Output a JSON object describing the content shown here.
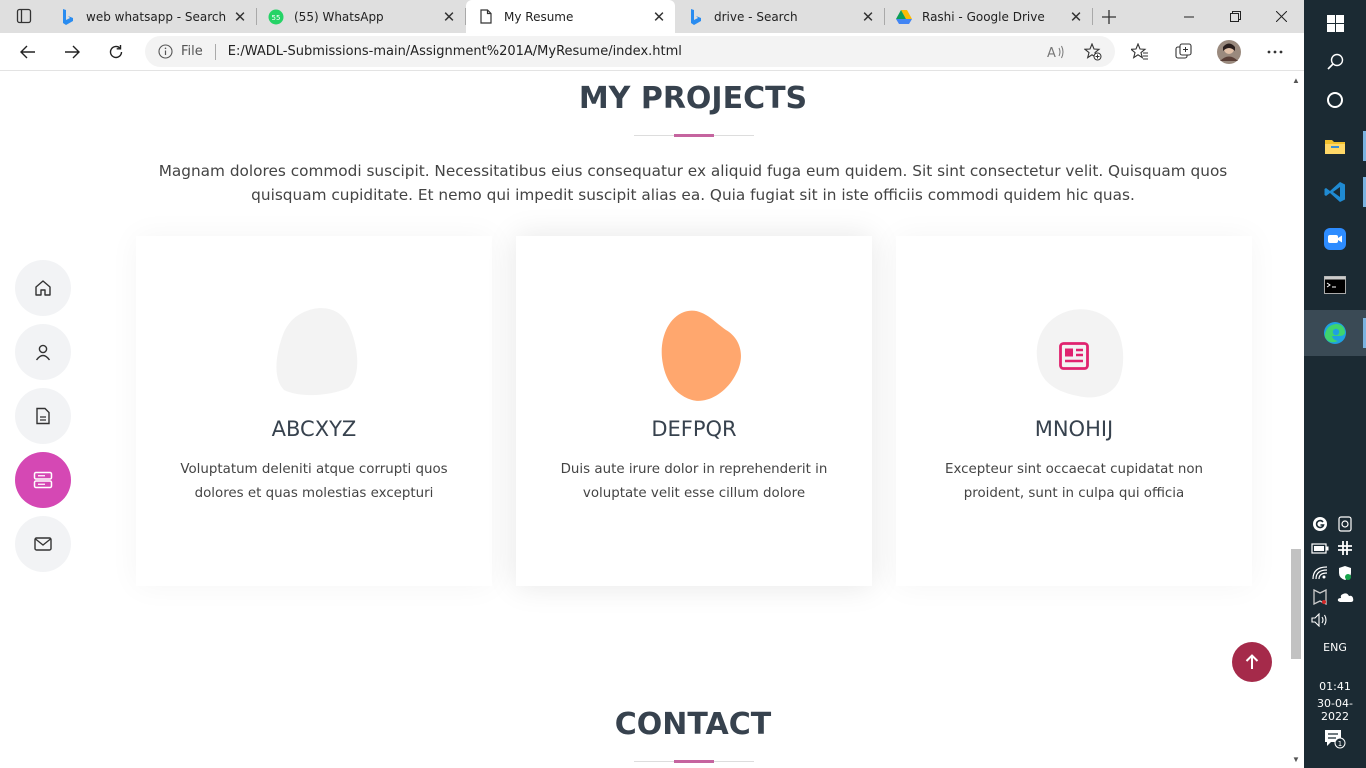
{
  "browser": {
    "tabs": [
      {
        "title": "web whatsapp - Search",
        "favicon": "bing-icon"
      },
      {
        "title": "(55) WhatsApp",
        "favicon": "whatsapp-icon",
        "badge": "55"
      },
      {
        "title": "My Resume",
        "favicon": "page-icon"
      },
      {
        "title": "drive - Search",
        "favicon": "bing-icon"
      },
      {
        "title": "Rashi - Google Drive",
        "favicon": "google-drive-icon"
      }
    ],
    "address": {
      "scheme": "File",
      "url": "E:/WADL-Submissions-main/Assignment%201A/MyResume/index.html"
    }
  },
  "page": {
    "projects": {
      "title": "MY PROJECTS",
      "description": "Magnam dolores commodi suscipit. Necessitatibus eius consequatur ex aliquid fuga eum quidem. Sit sint consectetur velit. Quisquam quos quisquam cupiditate. Et nemo qui impedit suscipit alias ea. Quia fugiat sit in iste officiis commodi quidem hic quas.",
      "cards": [
        {
          "title": "ABCXYZ",
          "text": "Voluptatum deleniti atque corrupti quos dolores et quas molestias excepturi",
          "blob_color": "#f3f3f3",
          "icon": "none"
        },
        {
          "title": "DEFPQR",
          "text": "Duis aute irure dolor in reprehenderit in voluptate velit esse cillum dolore",
          "blob_color": "#ffa76e",
          "icon": "none"
        },
        {
          "title": "MNOHIJ",
          "text": "Excepteur sint occaecat cupidatat non proident, sunt in culpa qui officia",
          "blob_color": "#f3f3f3",
          "icon": "newspaper-icon"
        }
      ]
    },
    "contact": {
      "title": "CONTACT"
    },
    "sidenav": [
      "home-icon",
      "person-icon",
      "file-icon",
      "server-icon",
      "envelope-icon"
    ],
    "accent": "#c5649f"
  },
  "taskbar": {
    "language": "ENG",
    "time": "01:41",
    "date": "30-04-2022",
    "notification_count": "1"
  }
}
